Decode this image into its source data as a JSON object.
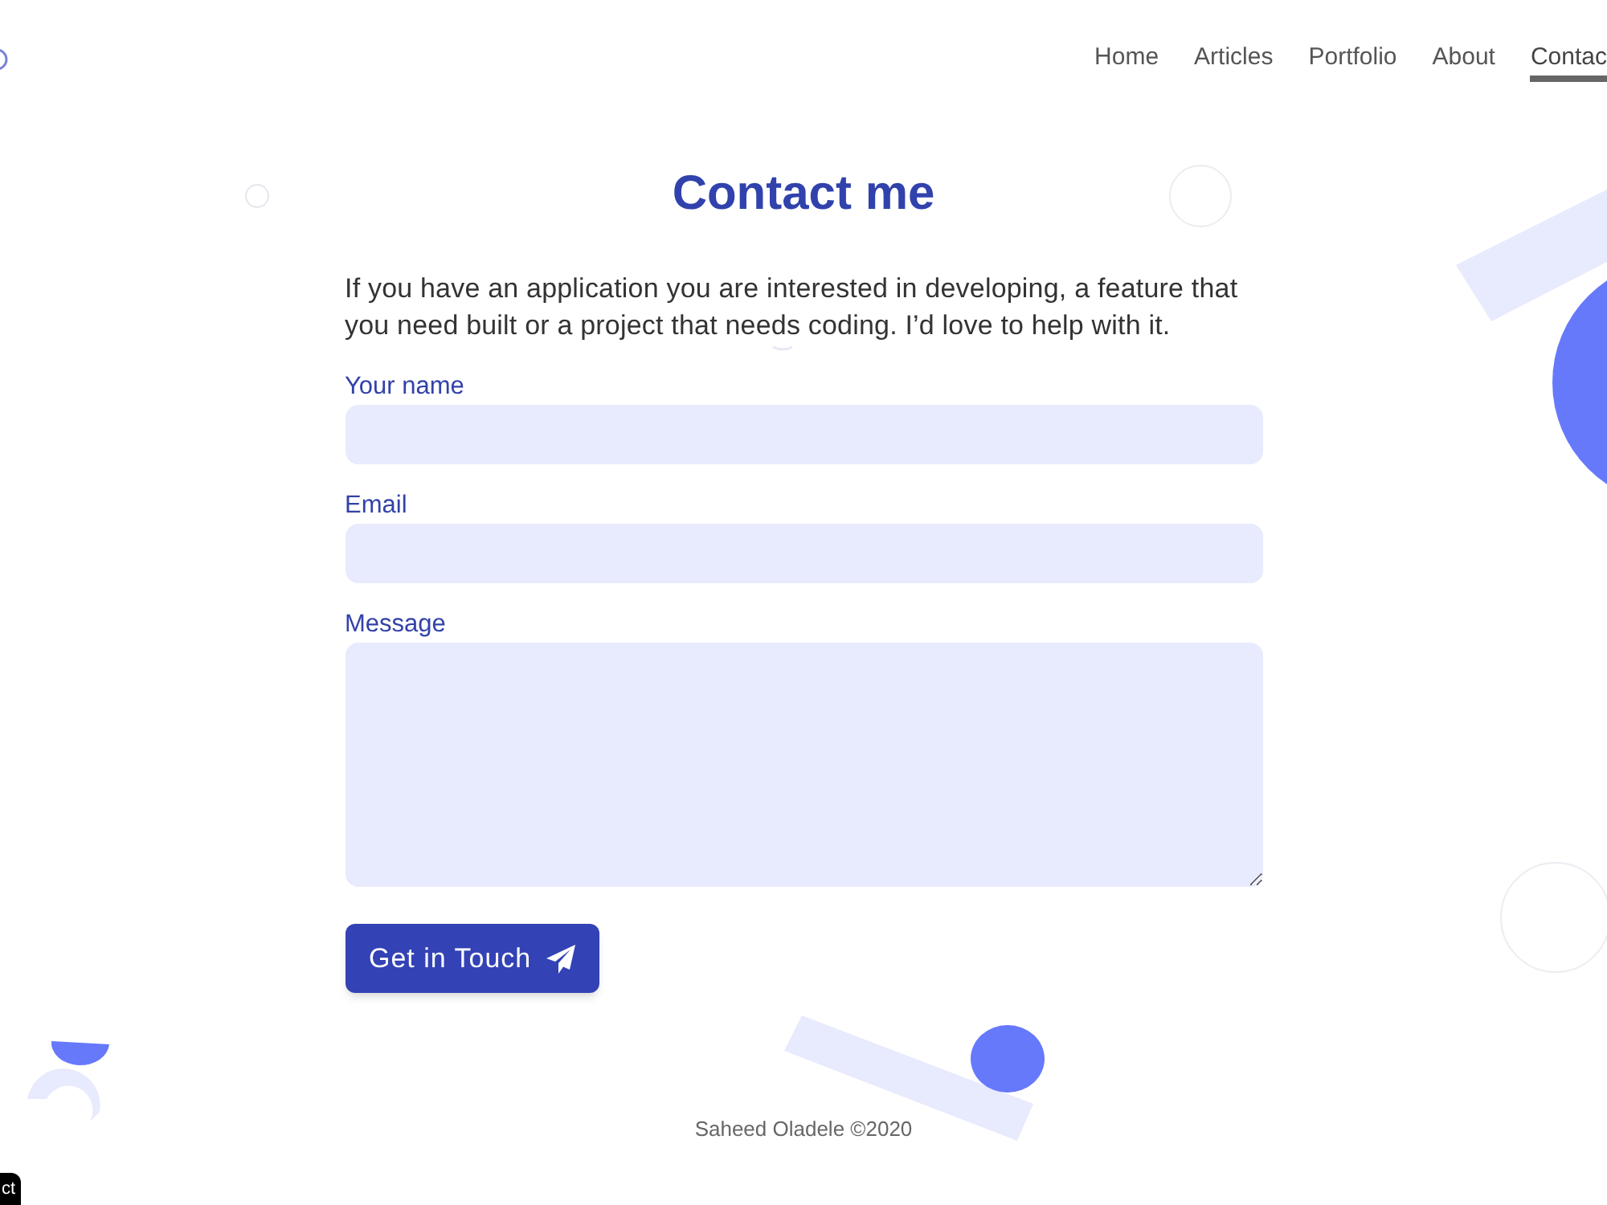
{
  "nav": {
    "items": [
      {
        "label": "Home",
        "selected": false
      },
      {
        "label": "Articles",
        "selected": false
      },
      {
        "label": "Portfolio",
        "selected": false
      },
      {
        "label": "About",
        "selected": false
      },
      {
        "label": "Contac",
        "selected": true
      }
    ]
  },
  "heading": "Contact me",
  "intro": "If you have an application you are interested in developing, a feature that you need built or a project that needs coding. I’d love to help with it.",
  "form": {
    "fields": [
      {
        "label": "Your name",
        "kind": "input"
      },
      {
        "label": "Email",
        "kind": "input"
      },
      {
        "label": "Message",
        "kind": "textarea"
      }
    ],
    "submit": "Get in Touch"
  },
  "footer": "Saheed Oladele ©2020",
  "corner_tag": "ct"
}
